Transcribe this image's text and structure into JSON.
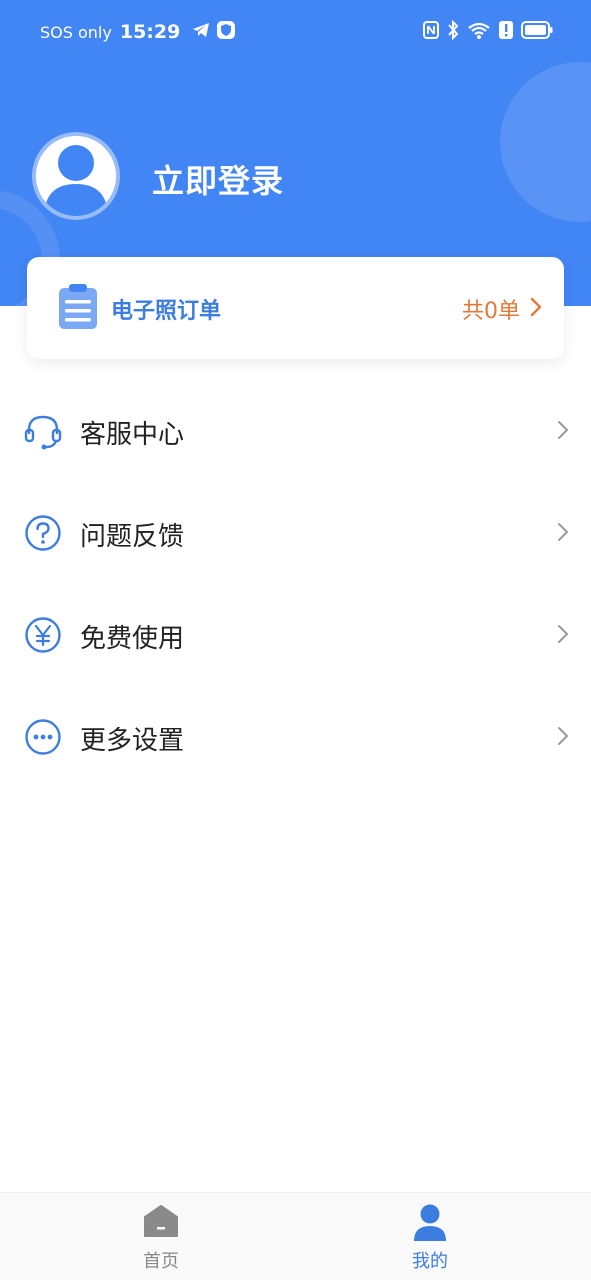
{
  "colors": {
    "brand": "#4285f4",
    "accent_text": "#3e7de0",
    "order_count": "#e2783a"
  },
  "status_bar": {
    "network": "SOS only",
    "time": "15:29",
    "icons_left": [
      "telegram-icon",
      "shield-icon"
    ],
    "icons_right": [
      "nfc-icon",
      "bluetooth-icon",
      "wifi-icon",
      "alert-icon",
      "battery-icon"
    ]
  },
  "profile": {
    "login_label": "立即登录",
    "avatar_icon": "user-avatar-icon"
  },
  "order_card": {
    "title": "电子照订单",
    "count_label": "共0单",
    "icon": "clipboard-icon"
  },
  "menu": {
    "items": [
      {
        "label": "客服中心",
        "icon": "headset-icon"
      },
      {
        "label": "问题反馈",
        "icon": "question-icon"
      },
      {
        "label": "免费使用",
        "icon": "yen-icon"
      },
      {
        "label": "更多设置",
        "icon": "more-icon"
      }
    ]
  },
  "tabbar": {
    "tabs": [
      {
        "label": "首页",
        "icon": "home-icon",
        "active": false
      },
      {
        "label": "我的",
        "icon": "user-icon",
        "active": true
      }
    ]
  }
}
